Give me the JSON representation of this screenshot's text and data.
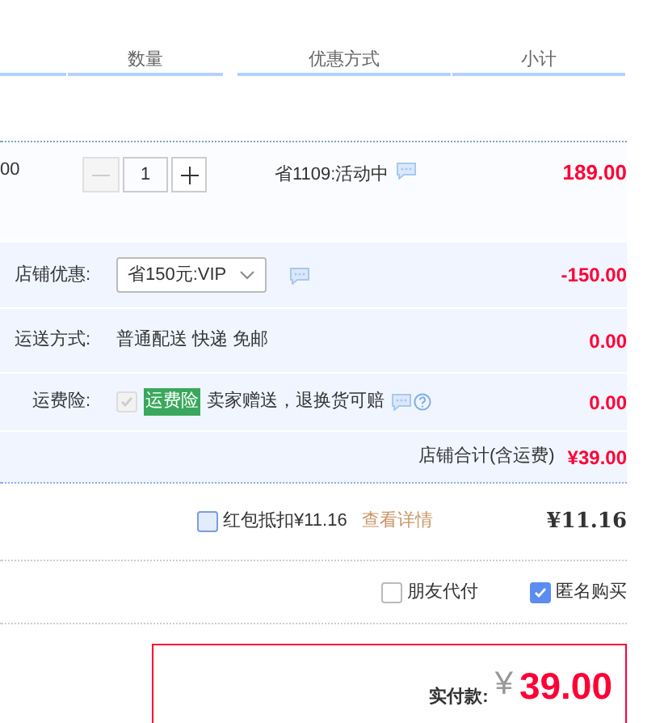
{
  "header": {
    "columns": [
      {
        "label": "数量"
      },
      {
        "label": "优惠方式"
      },
      {
        "label": "小计"
      }
    ]
  },
  "item": {
    "price": "00",
    "quantity": "1",
    "decrease_disabled": true,
    "promotion": "省1109:活动中",
    "subtotal": "189.00"
  },
  "shop": {
    "rows": [
      {
        "kind": "select",
        "label": "店铺优惠:",
        "value": "省150元:VIP",
        "amount": "-150.00"
      },
      {
        "kind": "text",
        "label": "运送方式:",
        "value": "普通配送 快递 免邮",
        "amount": "0.00"
      },
      {
        "kind": "insurance",
        "label": "运费险:",
        "checked": true,
        "disabled": true,
        "badge": "运费险",
        "value": "卖家赠送，退换货可赔",
        "amount": "0.00"
      }
    ],
    "total_label": "店铺合计(含运费)",
    "total": "¥39.00"
  },
  "red_packet": {
    "checked": false,
    "label": "红包抵扣¥11.16",
    "link": "查看详情",
    "amount": "¥11.16"
  },
  "options": [
    {
      "label": "朋友代付",
      "checked": false
    },
    {
      "label": "匿名购买",
      "checked": true
    }
  ],
  "payment": {
    "label": "实付款:",
    "currency": "¥",
    "amount": "39.00"
  }
}
